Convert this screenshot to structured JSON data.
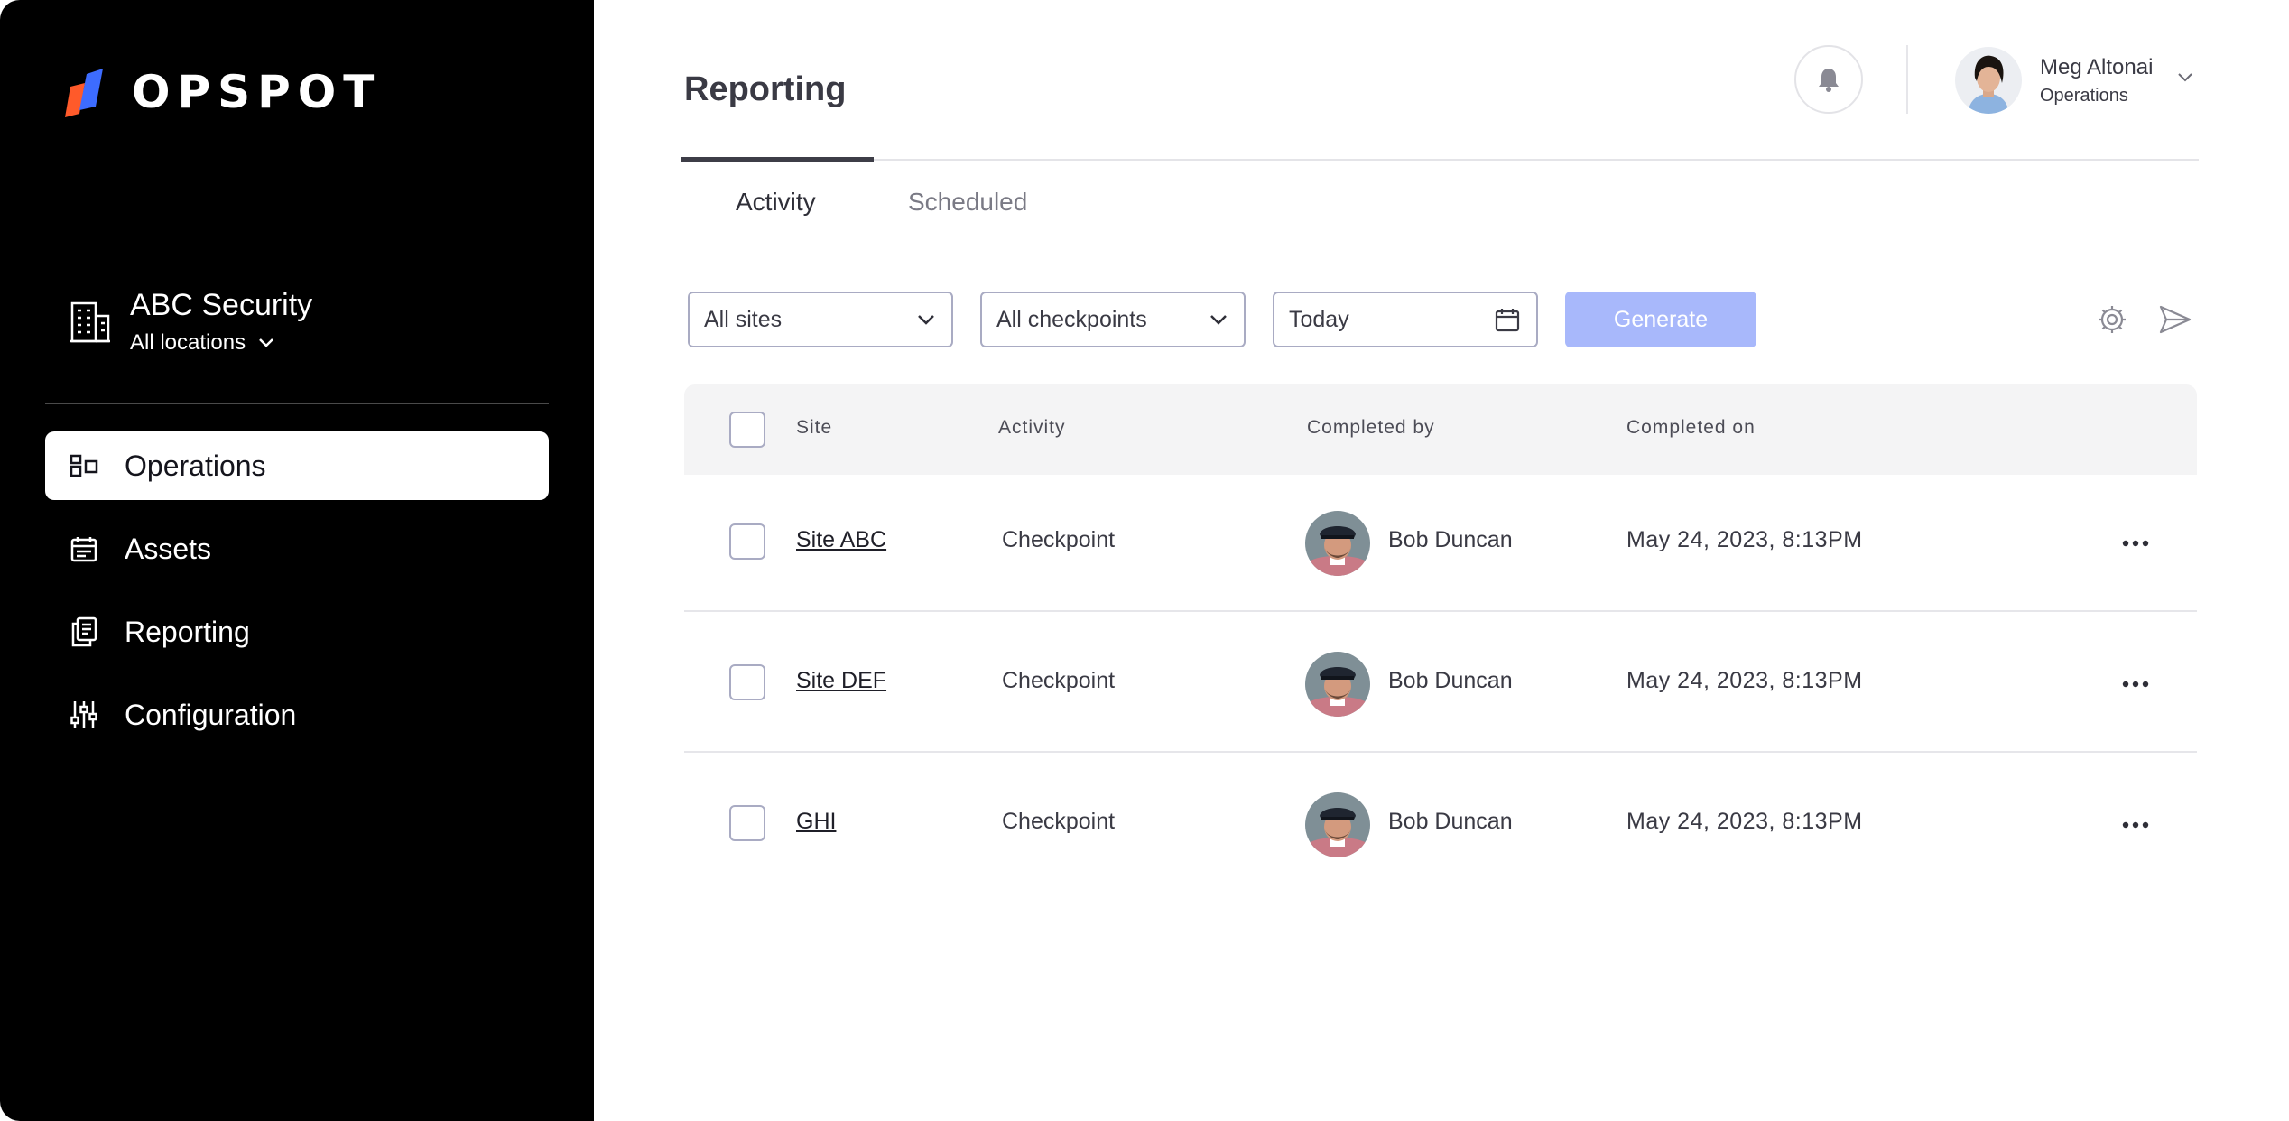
{
  "brand": {
    "name": "OPSPOT"
  },
  "organization": {
    "name": "ABC Security",
    "location_filter": "All locations"
  },
  "sidebar": {
    "items": [
      {
        "label": "Operations",
        "icon": "operations-icon",
        "active": true
      },
      {
        "label": "Assets",
        "icon": "assets-icon",
        "active": false
      },
      {
        "label": "Reporting",
        "icon": "reporting-icon",
        "active": false
      },
      {
        "label": "Configuration",
        "icon": "configuration-icon",
        "active": false
      }
    ]
  },
  "header": {
    "title": "Reporting",
    "user": {
      "name": "Meg Altonai",
      "role": "Operations"
    }
  },
  "tabs": [
    {
      "label": "Activity",
      "active": true
    },
    {
      "label": "Scheduled",
      "active": false
    }
  ],
  "filters": {
    "sites": "All sites",
    "checkpoints": "All checkpoints",
    "date": "Today",
    "generate_label": "Generate"
  },
  "table": {
    "headers": {
      "site": "Site",
      "activity": "Activity",
      "completed_by": "Completed by",
      "completed_on": "Completed on"
    },
    "rows": [
      {
        "site": "Site ABC",
        "activity": "Checkpoint",
        "completed_by": "Bob Duncan",
        "completed_on": "May 24, 2023, 8:13PM"
      },
      {
        "site": "Site DEF",
        "activity": "Checkpoint",
        "completed_by": "Bob Duncan",
        "completed_on": "May 24, 2023, 8:13PM"
      },
      {
        "site": "GHI",
        "activity": "Checkpoint",
        "completed_by": "Bob Duncan",
        "completed_on": "May 24, 2023, 8:13PM"
      }
    ]
  },
  "colors": {
    "sidebar_bg": "#000000",
    "accent_generate": "#a8b8fb",
    "logo_orange": "#ff5a2a",
    "logo_blue": "#3d6cff"
  }
}
